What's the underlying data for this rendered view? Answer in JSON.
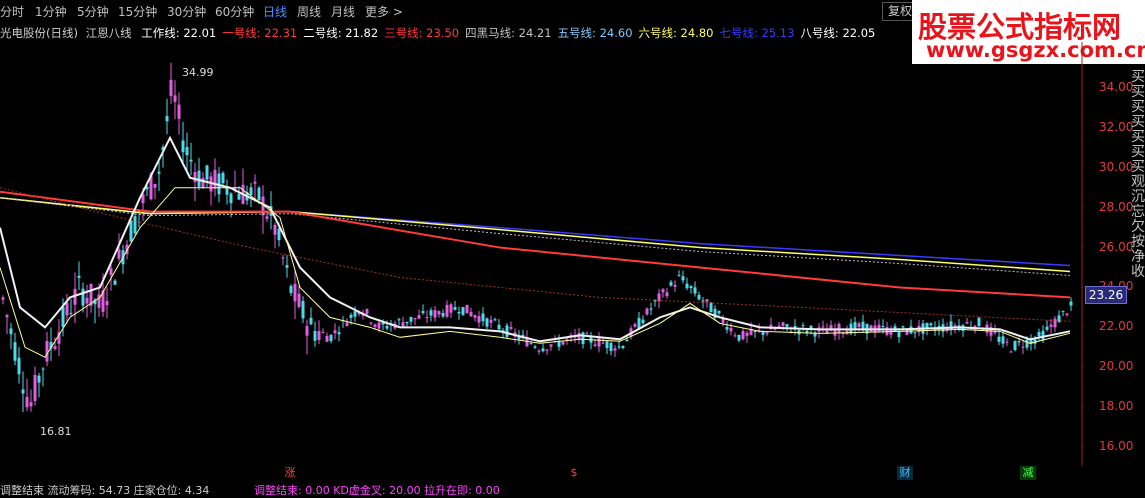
{
  "toolbar": {
    "tabs": [
      "分时",
      "1分钟",
      "5分钟",
      "15分钟",
      "30分钟",
      "60分钟",
      "日线",
      "周线",
      "月线",
      "更多 >"
    ],
    "active_tab": "日线",
    "fuquan_label": "复权"
  },
  "watermark": {
    "title": "股票公式指标网",
    "url": "www.gsgzx.com.cn"
  },
  "indicator": {
    "stock": "光电股份(日线)",
    "name": "江恩八线",
    "lines": [
      {
        "label": "工作线:",
        "value": "22.01",
        "color": "#ffffff"
      },
      {
        "label": "一号线:",
        "value": "22.31",
        "color": "#ff3b3b"
      },
      {
        "label": "二号线:",
        "value": "21.82",
        "color": "#ffffff"
      },
      {
        "label": "三号线:",
        "value": "23.50",
        "color": "#ff3b3b"
      },
      {
        "label": "四黑马线:",
        "value": "24.21",
        "color": "#c0c0c0"
      },
      {
        "label": "五号线:",
        "value": "24.60",
        "color": "#80c8ff"
      },
      {
        "label": "六号线:",
        "value": "24.80",
        "color": "#ffff66"
      },
      {
        "label": "七号线:",
        "value": "25.13",
        "color": "#3a3aff"
      },
      {
        "label": "八号线:",
        "value": "22.05",
        "color": "#ffffff"
      }
    ]
  },
  "y_axis": {
    "ticks": [
      "34.00",
      "32.00",
      "30.00",
      "28.00",
      "26.00",
      "24.00",
      "22.00",
      "20.00",
      "18.00",
      "16.00"
    ],
    "last_price": "23.26"
  },
  "annotations": {
    "high": "34.99",
    "low": "16.81"
  },
  "events": [
    {
      "label": "涨",
      "color": "#ff4040"
    },
    {
      "label": "$",
      "color": "#ff4040"
    },
    {
      "label": "财",
      "color": "#40c0ff"
    },
    {
      "label": "减",
      "color": "#40ff40"
    }
  ],
  "side_text": "买买买买买买买观沉忘欠按净收",
  "bottom_text": {
    "left": "调整结束  流动筹码: 54.73  庄家仓位: 4.34",
    "mid": "调整结束: 0.00  KD虚金叉: 20.00  拉升在即: 0.00"
  },
  "colors": {
    "up": "#ff3b3b",
    "down": "#4fd8e8",
    "accent": "#e8141b",
    "bg": "#000000"
  }
}
